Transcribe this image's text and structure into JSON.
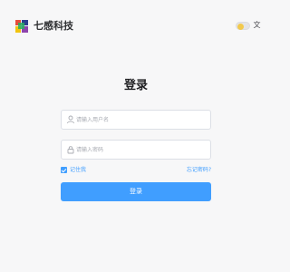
{
  "header": {
    "brand_name": "七感科技",
    "lang_icon_text": "文"
  },
  "login": {
    "title": "登录",
    "username_placeholder": "请输入用户名",
    "password_placeholder": "请输入密码",
    "remember_label": "记住我",
    "remember_checked": true,
    "forgot_label": "忘记密码?",
    "submit_label": "登录"
  },
  "icons": {
    "logo": "brand-logo-icon",
    "theme": "theme-toggle",
    "lang": "translate-icon",
    "user": "user-icon",
    "lock": "lock-icon"
  },
  "colors": {
    "primary": "#409eff",
    "background": "#f7f7f8",
    "theme_knob": "#f2c94c"
  }
}
